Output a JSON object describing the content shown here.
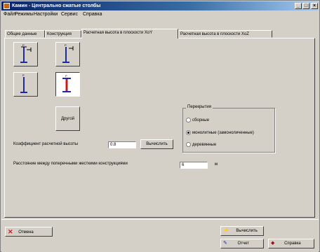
{
  "window": {
    "title": "Камин - Центрально сжатые столбы",
    "controls": [
      "_",
      "□",
      "×"
    ]
  },
  "menu": [
    "Файл",
    "Режимы",
    "Настройки",
    "Сервис",
    "Справка"
  ],
  "tabs": [
    {
      "label": "Общие данные",
      "active": false
    },
    {
      "label": "Конструкция",
      "active": false
    },
    {
      "label": "Расчетная высота в плоскости XoY",
      "active": true
    },
    {
      "label": "Расчетная высота в плоскости XoZ",
      "active": false
    }
  ],
  "schemes": [
    {
      "name": "scheme-1",
      "selected": false
    },
    {
      "name": "scheme-2",
      "selected": false
    },
    {
      "name": "scheme-3",
      "selected": false
    },
    {
      "name": "scheme-4",
      "selected": true
    }
  ],
  "other_button": "Другой",
  "coef": {
    "label": "Коэффициент расчетной высоты",
    "value": "0.8",
    "button": "Вычислить"
  },
  "distance": {
    "label": "Расстояние между поперечными жесткими конструкциями",
    "value": "6",
    "unit": "м"
  },
  "floors": {
    "title": "Перекрытия",
    "options": [
      {
        "label": "сборные",
        "checked": false
      },
      {
        "label": "монолитные (замоноличенные)",
        "checked": true
      },
      {
        "label": "деревянные",
        "checked": false
      }
    ]
  },
  "bottom": {
    "cancel": "Отмена",
    "compute": "Вычислить",
    "report": "Отчет",
    "help": "Справка"
  },
  "colors": {
    "accent_blue": "#1c2aa8",
    "selected_red": "#d01818",
    "cancel_x": "#d01818"
  }
}
